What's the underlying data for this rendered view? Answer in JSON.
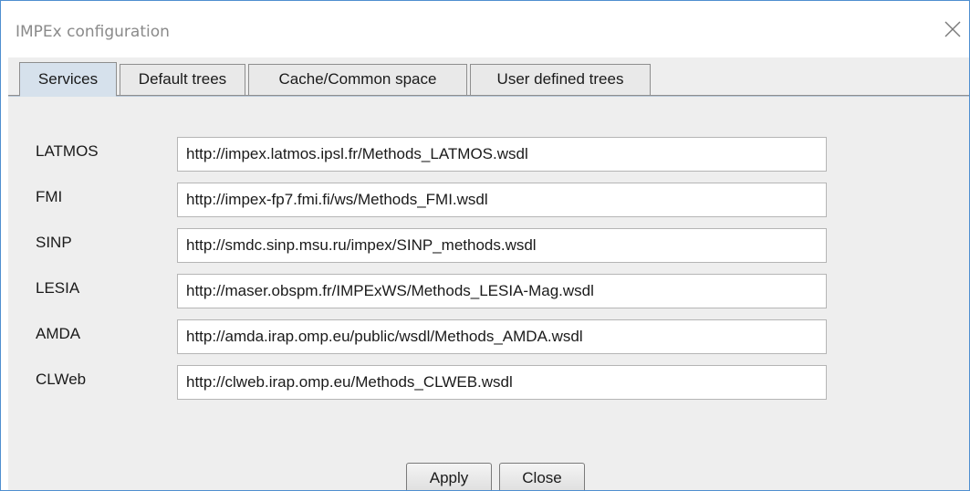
{
  "window": {
    "title": "IMPEx configuration",
    "close_icon": "close-x-icon"
  },
  "tabs": [
    {
      "label": "Services",
      "selected": true
    },
    {
      "label": "Default trees",
      "selected": false
    },
    {
      "label": "Cache/Common space",
      "selected": false
    },
    {
      "label": "User defined trees",
      "selected": false
    }
  ],
  "services": [
    {
      "name": "LATMOS",
      "url": "http://impex.latmos.ipsl.fr/Methods_LATMOS.wsdl"
    },
    {
      "name": "FMI",
      "url": "http://impex-fp7.fmi.fi/ws/Methods_FMI.wsdl"
    },
    {
      "name": "SINP",
      "url": "http://smdc.sinp.msu.ru/impex/SINP_methods.wsdl"
    },
    {
      "name": "LESIA",
      "url": "http://maser.obspm.fr/IMPExWS/Methods_LESIA-Mag.wsdl"
    },
    {
      "name": "AMDA",
      "url": "http://amda.irap.omp.eu/public/wsdl/Methods_AMDA.wsdl"
    },
    {
      "name": "CLWeb",
      "url": "http://clweb.irap.omp.eu/Methods_CLWEB.wsdl"
    }
  ],
  "buttons": {
    "apply": "Apply",
    "close": "Close"
  },
  "colors": {
    "window_border": "#4f8fd0",
    "panel_background": "#eeeeee",
    "selected_tab": "#d6e1ec"
  }
}
